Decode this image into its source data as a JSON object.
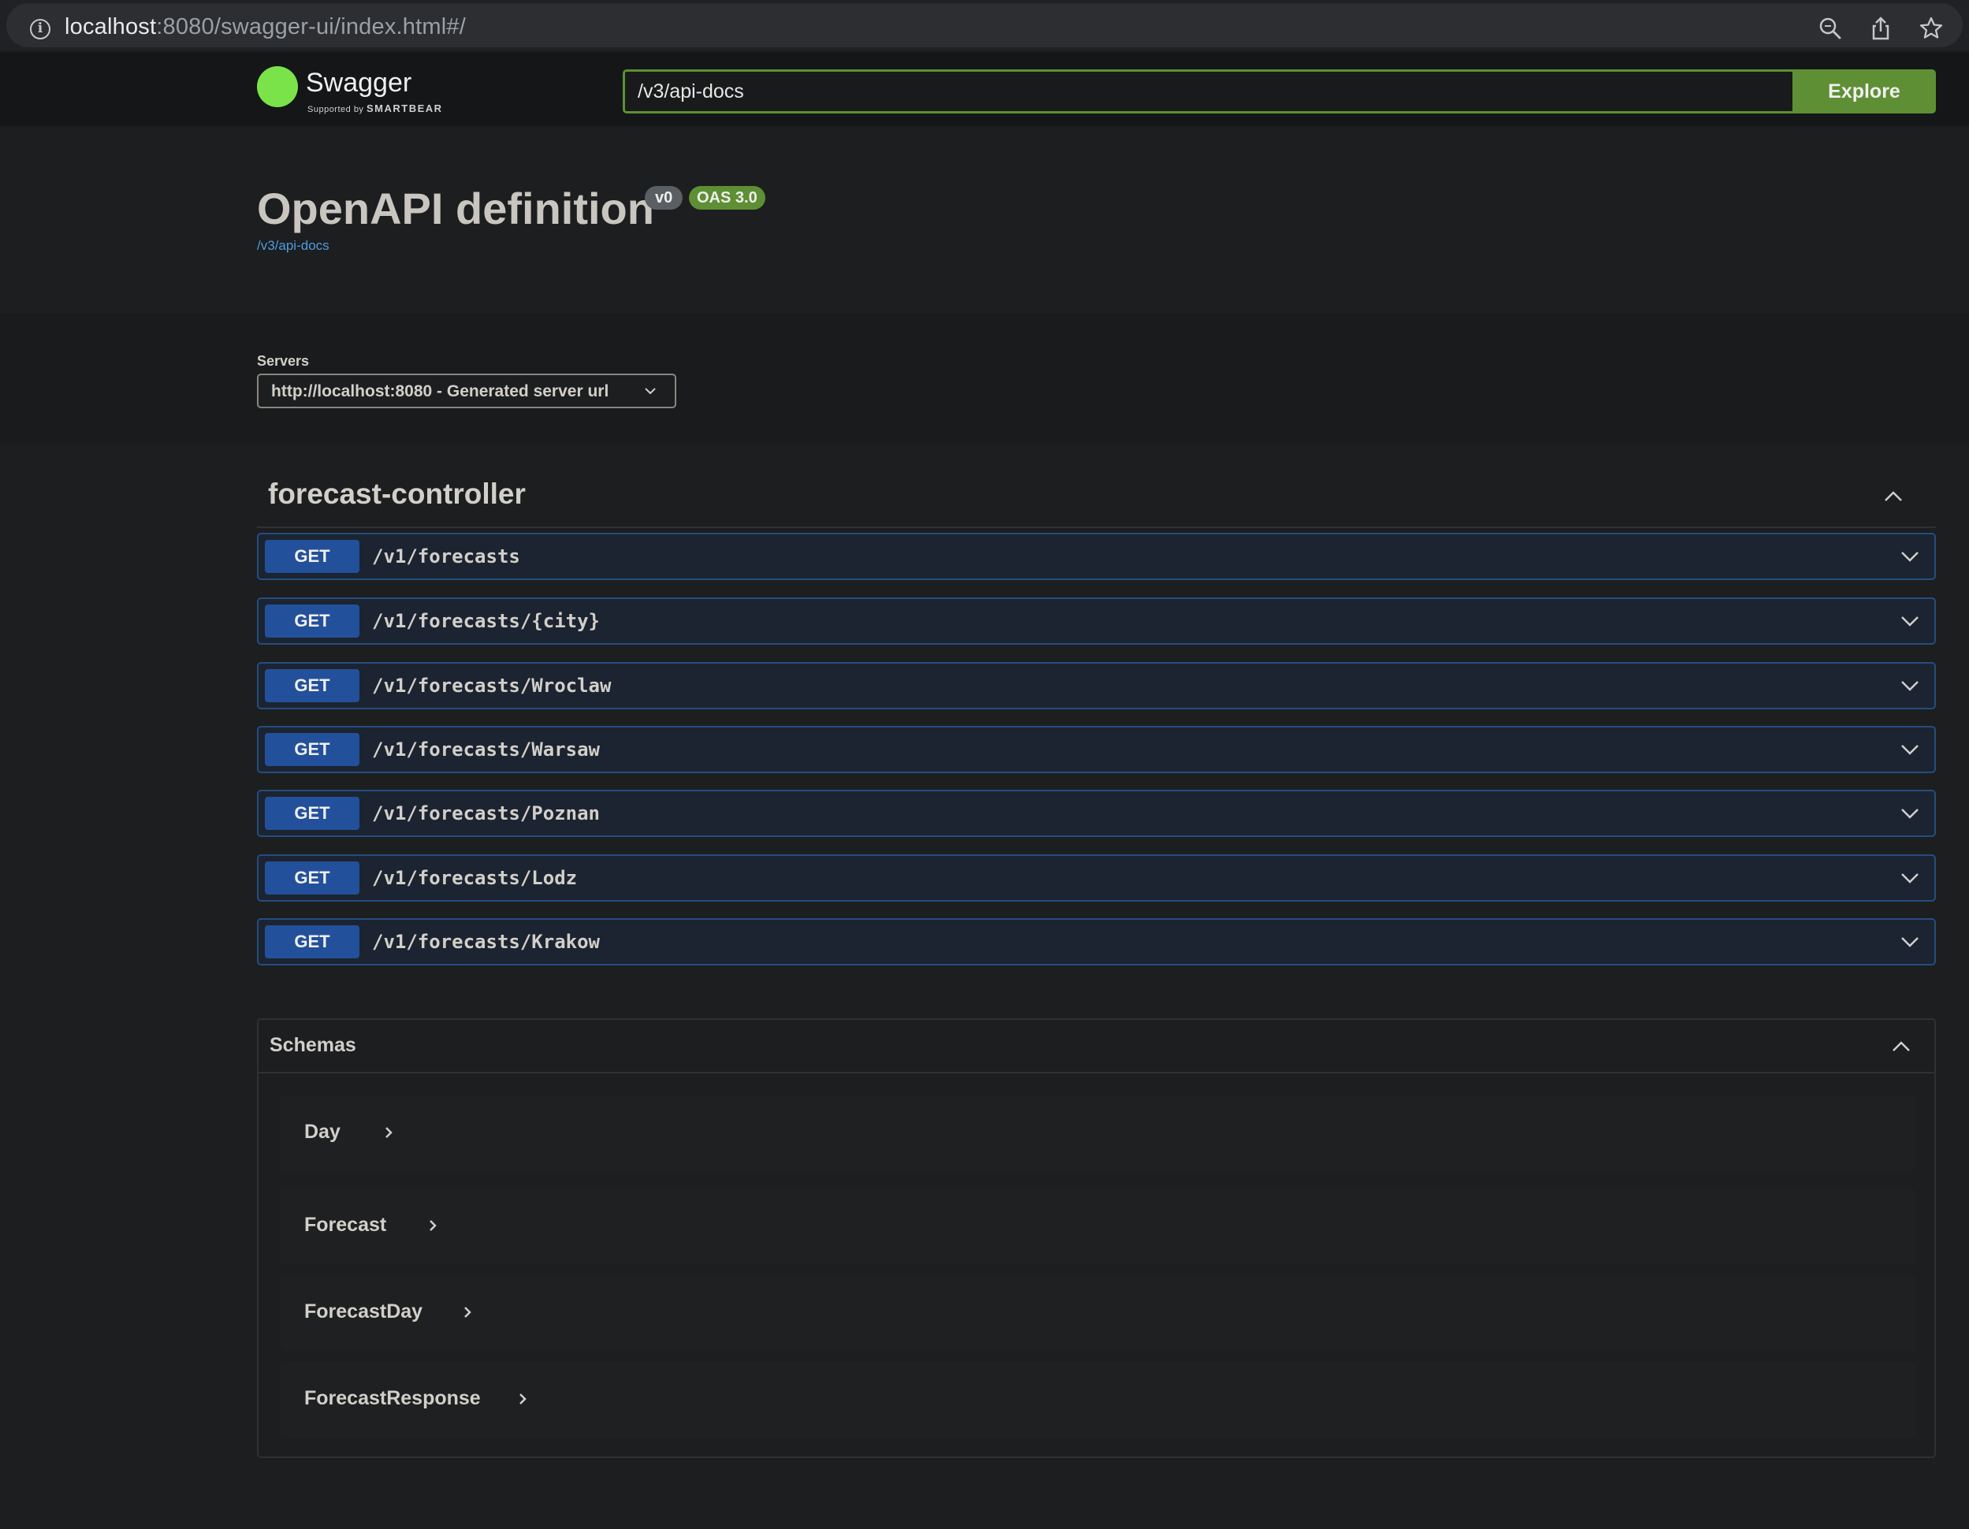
{
  "browser": {
    "url_host": "localhost",
    "url_rest": ":8080/swagger-ui/index.html#/"
  },
  "topbar": {
    "logo_text": "Swagger",
    "logo_sub_prefix": "Supported by",
    "logo_sub_brand": "SMARTBEAR",
    "url_value": "/v3/api-docs",
    "explore_label": "Explore"
  },
  "info": {
    "title": "OpenAPI definition",
    "version_badge": "v0",
    "oas_badge": "OAS 3.0",
    "spec_url": "/v3/api-docs"
  },
  "servers": {
    "label": "Servers",
    "selected": "http://localhost:8080 - Generated server url"
  },
  "tag": {
    "name": "forecast-controller",
    "operations": [
      {
        "method": "GET",
        "path": "/v1/forecasts"
      },
      {
        "method": "GET",
        "path": "/v1/forecasts/{city}"
      },
      {
        "method": "GET",
        "path": "/v1/forecasts/Wroclaw"
      },
      {
        "method": "GET",
        "path": "/v1/forecasts/Warsaw"
      },
      {
        "method": "GET",
        "path": "/v1/forecasts/Poznan"
      },
      {
        "method": "GET",
        "path": "/v1/forecasts/Lodz"
      },
      {
        "method": "GET",
        "path": "/v1/forecasts/Krakow"
      }
    ]
  },
  "schemas": {
    "title": "Schemas",
    "models": [
      "Day",
      "Forecast",
      "ForecastDay",
      "ForecastResponse"
    ]
  },
  "colors": {
    "accent_green": "#5e8f34",
    "get_blue": "#23509a",
    "background": "#1c1e1f"
  }
}
